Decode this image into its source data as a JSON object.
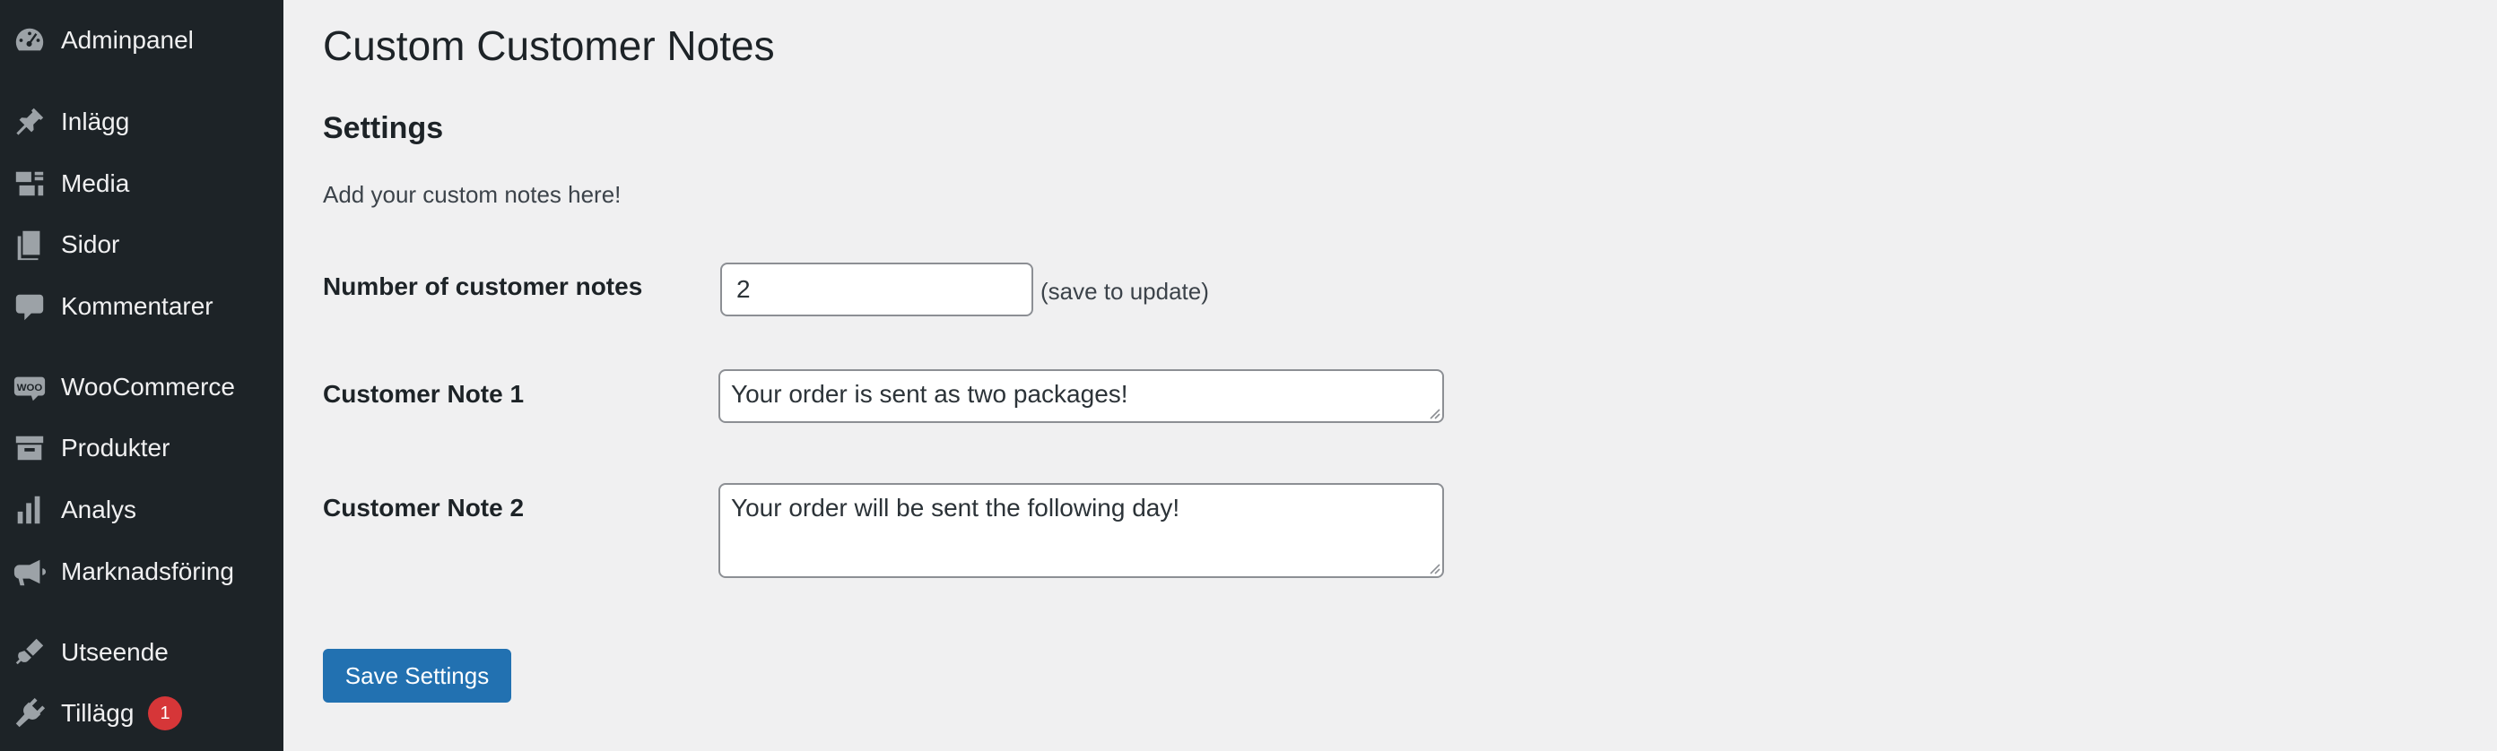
{
  "colors": {
    "sidebar_bg": "#1d2327",
    "page_bg": "#f0f0f1",
    "accent": "#2271b1",
    "badge": "#d63638"
  },
  "sidebar": {
    "items": [
      {
        "label": "Adminpanel",
        "icon": "dashboard-icon"
      },
      {
        "label": "Inlägg",
        "icon": "pin-icon"
      },
      {
        "label": "Media",
        "icon": "media-icon"
      },
      {
        "label": "Sidor",
        "icon": "pages-icon"
      },
      {
        "label": "Kommentarer",
        "icon": "comment-icon"
      },
      {
        "label": "WooCommerce",
        "icon": "woocommerce-icon"
      },
      {
        "label": "Produkter",
        "icon": "archive-icon"
      },
      {
        "label": "Analys",
        "icon": "bar-chart-icon"
      },
      {
        "label": "Marknadsföring",
        "icon": "megaphone-icon"
      },
      {
        "label": "Utseende",
        "icon": "brush-icon"
      },
      {
        "label": "Tillägg",
        "icon": "plugin-icon",
        "badge": "1"
      }
    ]
  },
  "main": {
    "page_title": "Custom Customer Notes",
    "section_title": "Settings",
    "section_description": "Add your custom notes here!",
    "fields": {
      "count": {
        "label": "Number of customer notes",
        "value": "2",
        "hint": "(save to update)"
      },
      "note1": {
        "label": "Customer Note 1",
        "value": "Your order is sent as two packages!"
      },
      "note2": {
        "label": "Customer Note 2",
        "value": "Your order will be sent the following day!"
      }
    },
    "save_label": "Save Settings"
  }
}
